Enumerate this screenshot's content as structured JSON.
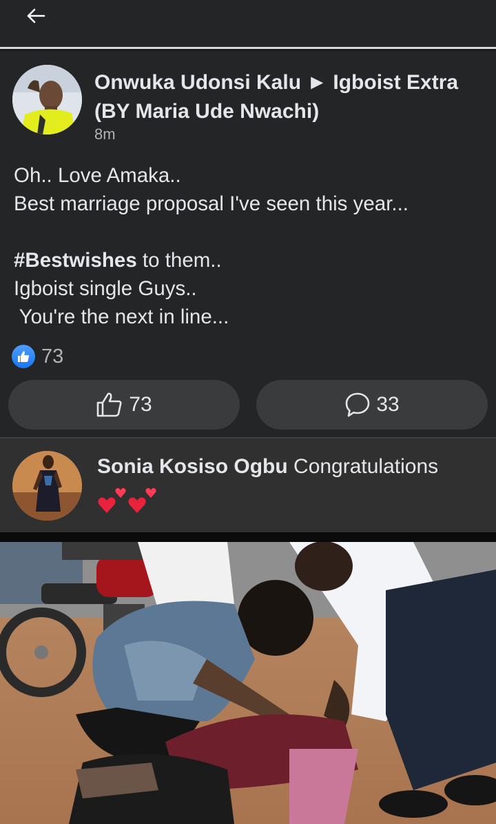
{
  "header": {
    "back_icon": "arrow-left-icon"
  },
  "post": {
    "author": "Onwuka Udonsi Kalu ► Igboist Extra (BY Maria Ude Nwachi)",
    "timestamp": "8m",
    "text_line1": "Oh.. Love Amaka..",
    "text_line2": "Best marriage proposal I've seen this year...",
    "hashtag": "#Bestwishes",
    "text_line4_rest": " to them..",
    "text_line5": "Igboist single Guys..",
    "text_line6": " You're the next in line...",
    "reaction_icon": "like-icon",
    "reaction_count": "73",
    "like_count": "73",
    "comment_count": "33"
  },
  "comment": {
    "author": "Sonia Kosiso Ogbu",
    "text": " Congratulations",
    "emoji_icon": "two-hearts-icon"
  },
  "colors": {
    "background": "#242526",
    "button": "#3a3b3c",
    "comment_bg": "#303031",
    "like_blue": "#1877f2",
    "heart_red": "#e8233b"
  }
}
